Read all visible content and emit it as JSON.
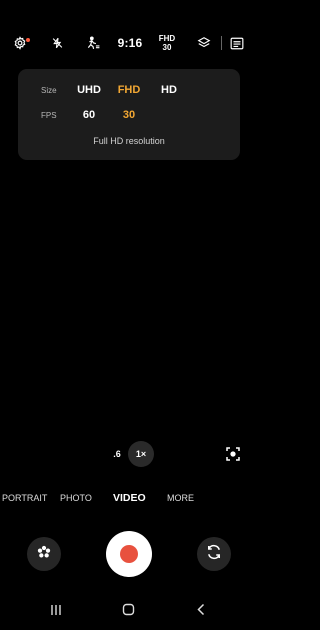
{
  "status_bar": {
    "time": "9:16",
    "fhd_line1": "FHD",
    "fhd_line2": "30",
    "icons": [
      "settings-icon",
      "flash-off-icon",
      "motion-icon",
      "filter-layers-icon",
      "gallery-thumbnail-icon"
    ]
  },
  "quality_panel": {
    "size_label": "Size",
    "fps_label": "FPS",
    "sizes": [
      "UHD",
      "FHD",
      "HD"
    ],
    "selected_size": "FHD",
    "fps_options": [
      "60",
      "30"
    ],
    "selected_fps": "30",
    "description": "Full HD resolution"
  },
  "zoom": {
    "wide_label": ".6",
    "normal_label": "1×"
  },
  "modes": {
    "items": [
      "PORTRAIT",
      "PHOTO",
      "VIDEO",
      "MORE"
    ],
    "active": "VIDEO"
  },
  "controls": {
    "left": "effects-flower-icon",
    "center": "record-button",
    "right": "switch-camera-icon"
  },
  "nav_bar": [
    "recent-apps-icon",
    "home-icon",
    "back-icon"
  ],
  "colors": {
    "accent": "#f2a733",
    "record": "#e8513e",
    "panel_bg": "#1c1c1c"
  }
}
